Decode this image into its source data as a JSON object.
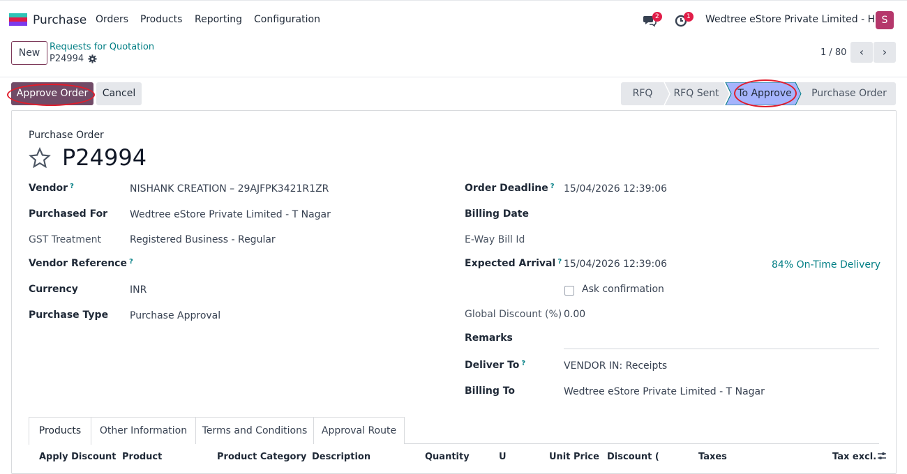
{
  "app": {
    "name": "Purchase"
  },
  "menu": [
    "Orders",
    "Products",
    "Reporting",
    "Configuration"
  ],
  "systray": {
    "messages_count": "2",
    "activities_count": "1",
    "company": "Wedtree eStore Private Limited - HO",
    "avatar_letter": "S"
  },
  "control": {
    "new_label": "New",
    "breadcrumb_parent": "Requests for Quotation",
    "breadcrumb_current": "P24994",
    "pager": "1 / 80"
  },
  "status": {
    "approve_label": "Approve Order",
    "cancel_label": "Cancel",
    "stages": [
      "RFQ",
      "RFQ Sent",
      "To Approve",
      "Purchase Order"
    ],
    "active_stage": "To Approve"
  },
  "form": {
    "title_label": "Purchase Order",
    "name": "P24994",
    "left": {
      "vendor_label": "Vendor",
      "vendor_value": "NISHANK CREATION – 29AJFPK3421R1ZR",
      "purchased_for_label": "Purchased For",
      "purchased_for_value": "Wedtree eStore Private Limited - T Nagar",
      "gst_label": "GST Treatment",
      "gst_value": "Registered Business - Regular",
      "vendor_ref_label": "Vendor Reference",
      "vendor_ref_value": "",
      "currency_label": "Currency",
      "currency_value": "INR",
      "purchase_type_label": "Purchase Type",
      "purchase_type_value": "Purchase Approval"
    },
    "right": {
      "order_deadline_label": "Order Deadline",
      "order_deadline_value": "15/04/2026 12:39:06",
      "billing_date_label": "Billing Date",
      "billing_date_value": "",
      "eway_label": "E-Way Bill Id",
      "eway_value": "",
      "expected_arrival_label": "Expected Arrival",
      "expected_arrival_value": "15/04/2026 12:39:06",
      "on_time": "84% On-Time Delivery",
      "ask_confirmation_label": "Ask confirmation",
      "global_discount_label": "Global Discount (%)",
      "global_discount_value": "0.00",
      "remarks_label": "Remarks",
      "deliver_to_label": "Deliver To",
      "deliver_to_value": "VENDOR IN: Receipts",
      "billing_to_label": "Billing To",
      "billing_to_value": "Wedtree eStore Private Limited - T Nagar"
    },
    "help_mark": "?"
  },
  "tabs": [
    "Products",
    "Other Information",
    "Terms and Conditions",
    "Approval Route"
  ],
  "columns": [
    "Apply Discount",
    "Product",
    "Product Category",
    "Description",
    "Quantity",
    "U",
    "Unit Price",
    "Discount (",
    "Taxes",
    "Tax excl."
  ],
  "colors": {
    "brand": "#714b67",
    "link": "#017e84",
    "stage_active": "#a5b4fc",
    "badge": "#e11d48",
    "annotation": "#e11d2c"
  }
}
